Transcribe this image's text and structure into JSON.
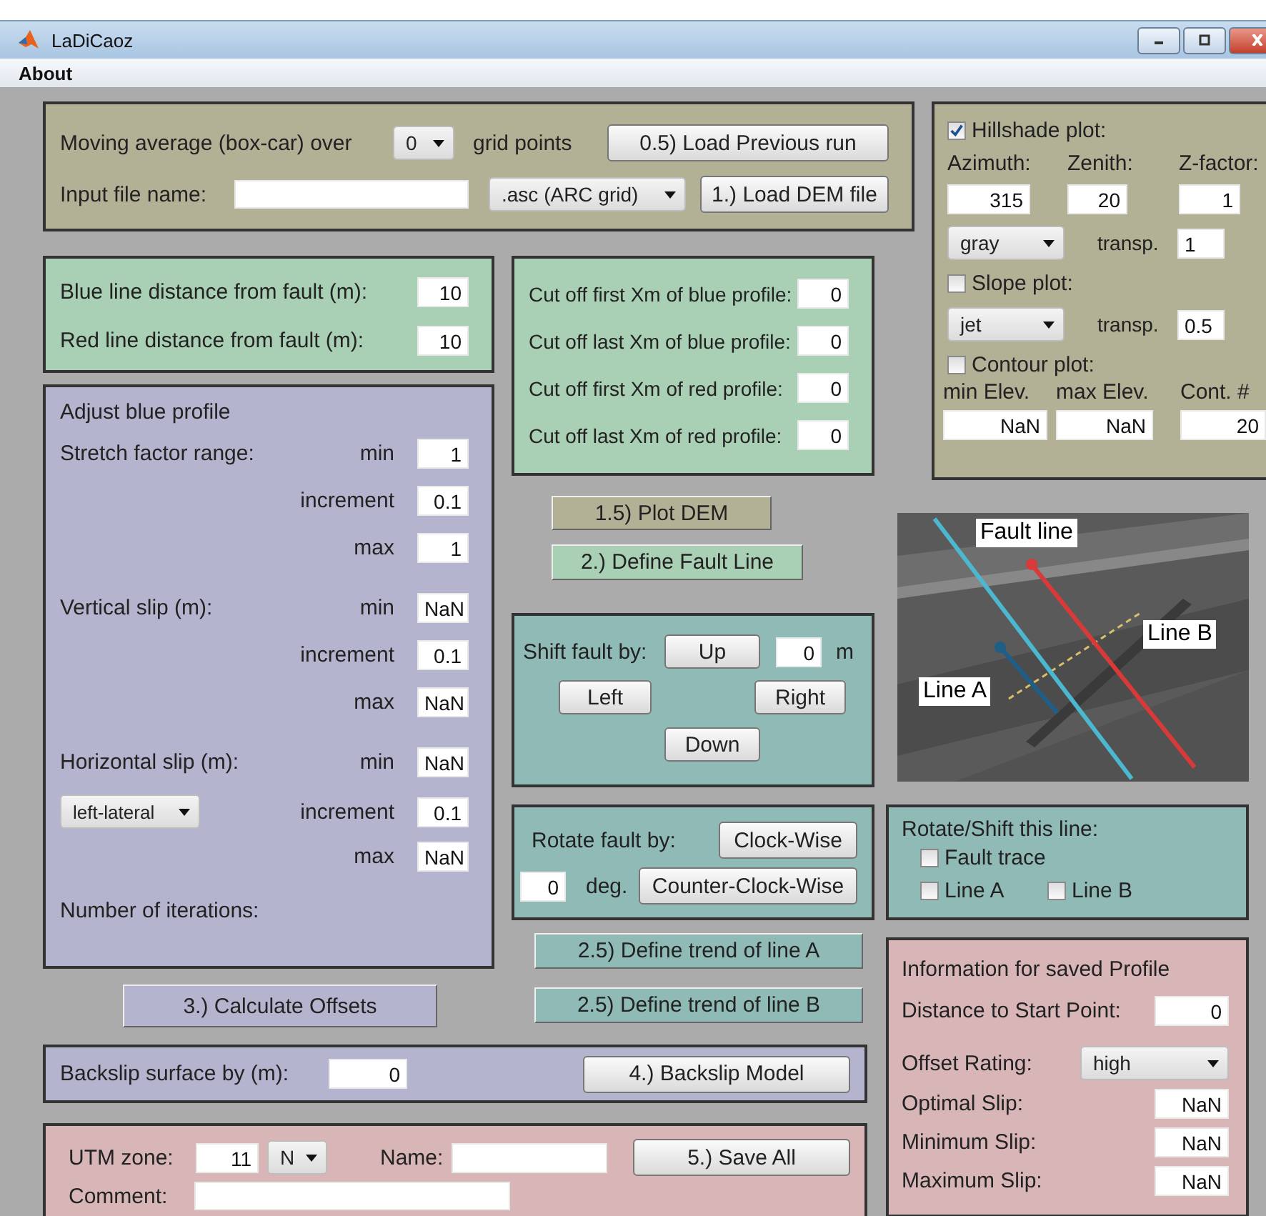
{
  "window": {
    "title": "LaDiCaoz"
  },
  "menu": [
    "About"
  ],
  "load_panel": {
    "moving_average_label": "Moving average (box-car) over",
    "moving_average": "0",
    "grid_points_label": "grid points",
    "load_previous_button": "0.5) Load Previous run",
    "input_file_label": "Input file name:",
    "file_format": ".asc (ARC grid)",
    "load_dem_button": "1.) Load DEM file"
  },
  "distance_panel": {
    "fields": [
      {
        "label": "Blue line distance from fault (m):",
        "value": "10"
      },
      {
        "label": "Red line distance from fault (m):",
        "value": "10"
      }
    ]
  },
  "adjust_panel": {
    "title": "Adjust blue profile",
    "groups": [
      {
        "label": "Stretch factor range:",
        "rows": [
          {
            "label": "min",
            "value": "1"
          },
          {
            "label": "increment",
            "value": "0.1"
          },
          {
            "label": "max",
            "value": "1"
          }
        ]
      },
      {
        "label": "Vertical slip (m):",
        "rows": [
          {
            "label": "min",
            "value": "NaN"
          },
          {
            "label": "increment",
            "value": "0.1"
          },
          {
            "label": "max",
            "value": "NaN"
          }
        ]
      },
      {
        "label": "Horizontal slip (m):",
        "dropdown": "left-lateral",
        "rows": [
          {
            "label": "min",
            "value": "NaN"
          },
          {
            "label": "increment",
            "value": "0.1"
          },
          {
            "label": "max",
            "value": "NaN"
          }
        ]
      }
    ],
    "iterations_label": "Number of iterations:"
  },
  "calculate_button": "3.) Calculate Offsets",
  "cutoff_panel": {
    "fields": [
      {
        "label": "Cut off first Xm of blue profile:",
        "value": "0"
      },
      {
        "label": "Cut off last Xm of blue profile:",
        "value": "0"
      },
      {
        "label": "Cut off first Xm of red profile:",
        "value": "0"
      },
      {
        "label": "Cut off last Xm of red profile:",
        "value": "0"
      }
    ]
  },
  "plot_dem_button": "1.5) Plot DEM",
  "define_fault_button": "2.) Define Fault Line",
  "shift_panel": {
    "label": "Shift fault by:",
    "up": "Up",
    "value": "0",
    "unit": "m",
    "left": "Left",
    "right": "Right",
    "down": "Down"
  },
  "rotate_panel": {
    "label": "Rotate fault by:",
    "clockwise": "Clock-Wise",
    "value": "0",
    "unit": "deg.",
    "counter_clockwise": "Counter-Clock-Wise"
  },
  "trend_buttons": [
    "2.5) Define trend of line A",
    "2.5) Define trend of line B"
  ],
  "backslip_panel": {
    "label": "Backslip surface by (m):",
    "value": "0",
    "button": "4.) Backslip Model"
  },
  "save_panel": {
    "utm_label": "UTM zone:",
    "utm_zone": "11",
    "hemisphere": "N",
    "name_label": "Name:",
    "save_button": "5.) Save All",
    "comment_label": "Comment:"
  },
  "hillshade_panel": {
    "hillshade": {
      "label": "Hillshade plot:",
      "checked": true
    },
    "columns": [
      "Azimuth:",
      "Zenith:",
      "Z-factor:"
    ],
    "values": [
      "315",
      "20",
      "1"
    ],
    "colormap": "gray",
    "transp_label": "transp.",
    "transp": "1",
    "slope": {
      "label": "Slope plot:",
      "checked": false,
      "colormap": "jet",
      "transp_label": "transp.",
      "transp": "0.5"
    },
    "contour": {
      "label": "Contour plot:",
      "checked": false,
      "columns": [
        "min Elev.",
        "max Elev.",
        "Cont. #"
      ],
      "values": [
        "NaN",
        "NaN",
        "20"
      ]
    }
  },
  "map_figure": {
    "labels": [
      "Fault line",
      "Line B",
      "Line A"
    ]
  },
  "line_panel": {
    "title": "Rotate/Shift this line:",
    "options": [
      {
        "label": "Fault trace",
        "checked": false
      },
      {
        "label": "Line A",
        "checked": false
      },
      {
        "label": "Line B",
        "checked": false
      }
    ]
  },
  "info_panel": {
    "title": "Information for saved Profile",
    "distance_label": "Distance to Start Point:",
    "distance": "0",
    "rating_label": "Offset Rating:",
    "rating": "high",
    "slips": [
      {
        "label": "Optimal Slip:",
        "value": "NaN"
      },
      {
        "label": "Minimum Slip:",
        "value": "NaN"
      },
      {
        "label": "Maximum Slip:",
        "value": "NaN"
      }
    ]
  }
}
